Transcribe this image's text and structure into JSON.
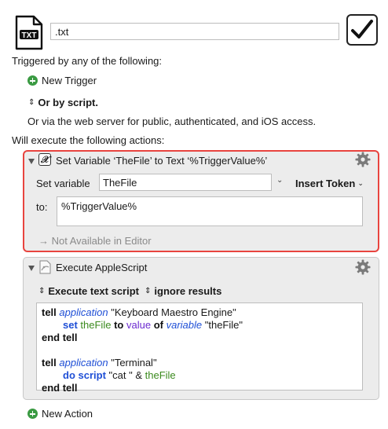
{
  "header": {
    "file_icon_label": "TXT",
    "name_value": ".txt",
    "enabled": true
  },
  "triggers": {
    "heading": "Triggered by any of the following:",
    "new_trigger": "New Trigger",
    "or_by_script": "Or by script.",
    "web_server_text": "Or via the web server for public, authenticated, and iOS access."
  },
  "actions": {
    "heading": "Will execute the following actions:",
    "set_variable": {
      "title": "Set Variable ‘TheFile’ to Text ‘%TriggerValue%’",
      "set_variable_label": "Set variable",
      "variable_value": "TheFile",
      "insert_token": "Insert Token",
      "to_label": "to:",
      "to_value": "%TriggerValue%",
      "not_available": "→ Not Available in Editor"
    },
    "applescript": {
      "title": "Execute AppleScript",
      "mode": "Execute text script",
      "results": "ignore results",
      "code": {
        "l1_tell": "tell",
        "l1_app": "application",
        "l1_str": "\"Keyboard Maestro Engine\"",
        "l2_set": "set",
        "l2_var": "theFile",
        "l2_to": "to",
        "l2_value": "value",
        "l2_of": "of",
        "l2_variable": "variable",
        "l2_str": "\"theFile\"",
        "l3_end": "end tell",
        "l5_tell": "tell",
        "l5_app": "application",
        "l5_str": "\"Terminal\"",
        "l6_do": "do script",
        "l6_str": "\"cat \" &",
        "l6_var": "theFile",
        "l7_end": "end tell"
      }
    },
    "new_action": "New Action"
  },
  "colors": {
    "selection_border": "#e8443f",
    "plus_green": "#3a9a42",
    "keyword_blue": "#1f4fd6",
    "variable_green": "#3b8a1e",
    "property_purple": "#6c2bd0"
  }
}
